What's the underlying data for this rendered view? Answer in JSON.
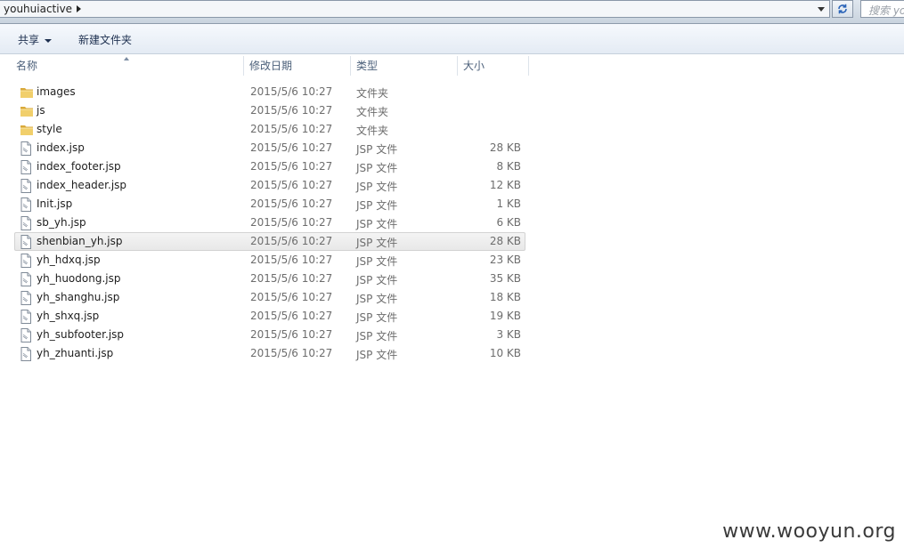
{
  "address_bar": {
    "path": "youhuiactive",
    "search_placeholder": "搜索 yo"
  },
  "toolbar": {
    "share_label": "共享",
    "new_folder_label": "新建文件夹"
  },
  "columns": {
    "name": "名称",
    "date": "修改日期",
    "type": "类型",
    "size": "大小"
  },
  "files": [
    {
      "name": "images",
      "date": "2015/5/6 10:27",
      "type": "文件夹",
      "size": "",
      "icon": "folder-icon"
    },
    {
      "name": "js",
      "date": "2015/5/6 10:27",
      "type": "文件夹",
      "size": "",
      "icon": "folder-icon"
    },
    {
      "name": "style",
      "date": "2015/5/6 10:27",
      "type": "文件夹",
      "size": "",
      "icon": "folder-icon"
    },
    {
      "name": "index.jsp",
      "date": "2015/5/6 10:27",
      "type": "JSP 文件",
      "size": "28 KB",
      "icon": "file-icon"
    },
    {
      "name": "index_footer.jsp",
      "date": "2015/5/6 10:27",
      "type": "JSP 文件",
      "size": "8 KB",
      "icon": "file-icon"
    },
    {
      "name": "index_header.jsp",
      "date": "2015/5/6 10:27",
      "type": "JSP 文件",
      "size": "12 KB",
      "icon": "file-icon"
    },
    {
      "name": "Init.jsp",
      "date": "2015/5/6 10:27",
      "type": "JSP 文件",
      "size": "1 KB",
      "icon": "file-icon"
    },
    {
      "name": "sb_yh.jsp",
      "date": "2015/5/6 10:27",
      "type": "JSP 文件",
      "size": "6 KB",
      "icon": "file-icon"
    },
    {
      "name": "shenbian_yh.jsp",
      "date": "2015/5/6 10:27",
      "type": "JSP 文件",
      "size": "28 KB",
      "icon": "file-icon",
      "hover": true
    },
    {
      "name": "yh_hdxq.jsp",
      "date": "2015/5/6 10:27",
      "type": "JSP 文件",
      "size": "23 KB",
      "icon": "file-icon"
    },
    {
      "name": "yh_huodong.jsp",
      "date": "2015/5/6 10:27",
      "type": "JSP 文件",
      "size": "35 KB",
      "icon": "file-icon"
    },
    {
      "name": "yh_shanghu.jsp",
      "date": "2015/5/6 10:27",
      "type": "JSP 文件",
      "size": "18 KB",
      "icon": "file-icon"
    },
    {
      "name": "yh_shxq.jsp",
      "date": "2015/5/6 10:27",
      "type": "JSP 文件",
      "size": "19 KB",
      "icon": "file-icon"
    },
    {
      "name": "yh_subfooter.jsp",
      "date": "2015/5/6 10:27",
      "type": "JSP 文件",
      "size": "3 KB",
      "icon": "file-icon"
    },
    {
      "name": "yh_zhuanti.jsp",
      "date": "2015/5/6 10:27",
      "type": "JSP 文件",
      "size": "10 KB",
      "icon": "file-icon"
    }
  ],
  "watermark": "www.wooyun.org",
  "colors": {
    "folder": "#e8c25a",
    "hover_row": "#ececec",
    "header_text": "#4c607a"
  }
}
